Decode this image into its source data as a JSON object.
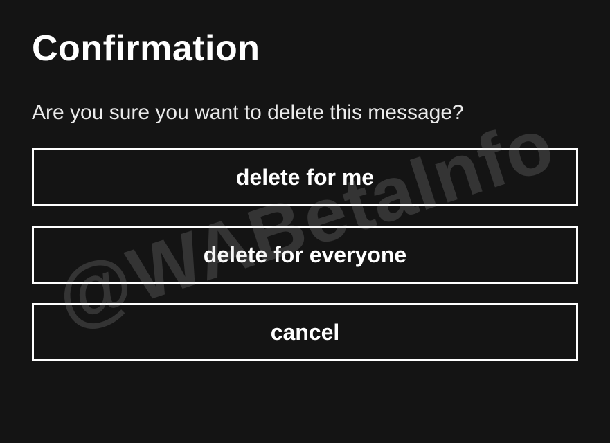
{
  "dialog": {
    "title": "Confirmation",
    "message": "Are you sure you want to delete this message?",
    "buttons": {
      "delete_me": "delete for me",
      "delete_everyone": "delete for everyone",
      "cancel": "cancel"
    }
  },
  "watermark": "@WABetaInfo"
}
